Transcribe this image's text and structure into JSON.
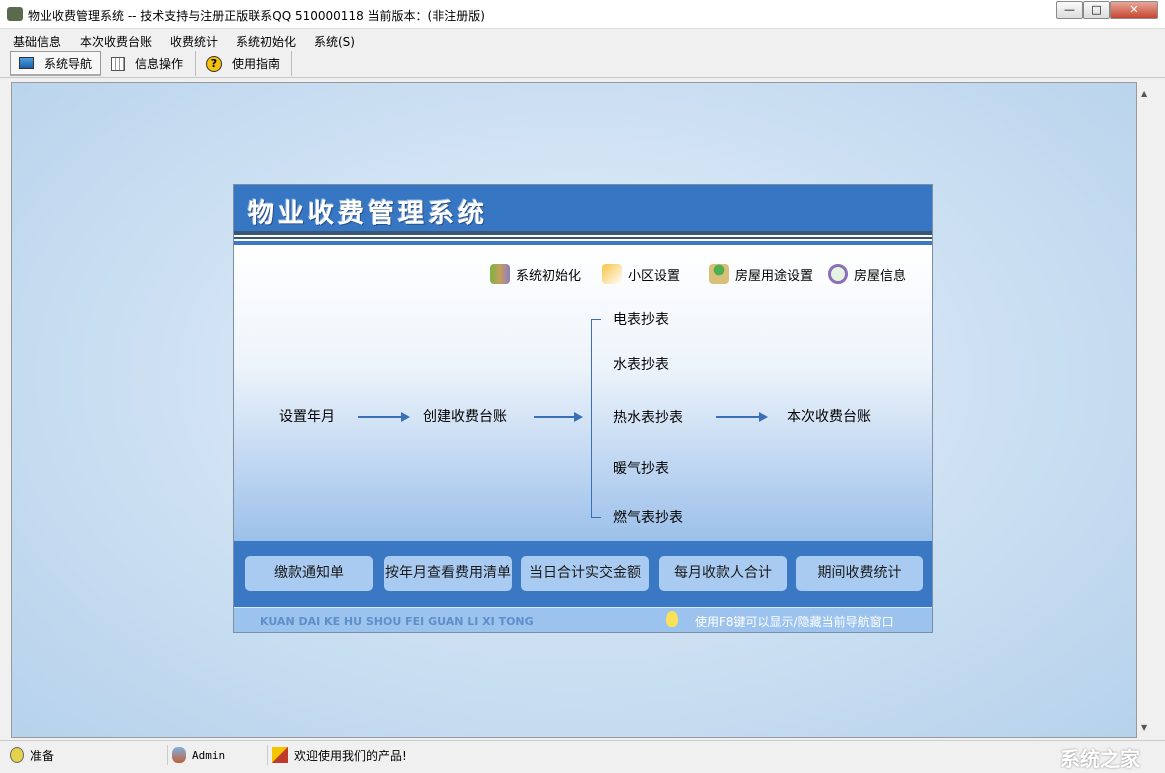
{
  "window": {
    "title": "物业收费管理系统 -- 技术支持与注册正版联系QQ 510000118    当前版本：(非注册版)",
    "min": "—",
    "max": "□",
    "close": "✕"
  },
  "menu": [
    "基础信息",
    "本次收费台账",
    "收费统计",
    "系统初始化",
    "系统(S)"
  ],
  "toolbar": [
    "系统导航",
    "信息操作",
    "使用指南"
  ],
  "panel": {
    "title": "物业收费管理系统",
    "quick": [
      "系统初始化",
      "小区设置",
      "房屋用途设置",
      "房屋信息"
    ],
    "flow": {
      "start": "设置年月",
      "create": "创建收费台账",
      "readings": [
        "电表抄表",
        "水表抄表",
        "热水表抄表",
        "暖气抄表",
        "燃气表抄表"
      ],
      "end": "本次收费台账"
    },
    "buttons": [
      "缴款通知单",
      "按年月查看费用清单",
      "当日合计实交金额",
      "每月收款人合计",
      "期间收费统计"
    ],
    "pinyin": "KUAN DAI KE HU SHOU FEI GUAN LI XI TONG",
    "tip": "使用F8键可以显示/隐藏当前导航窗口"
  },
  "status": [
    "准备",
    "Admin",
    "欢迎使用我们的产品!"
  ],
  "watermark": "系统之家"
}
